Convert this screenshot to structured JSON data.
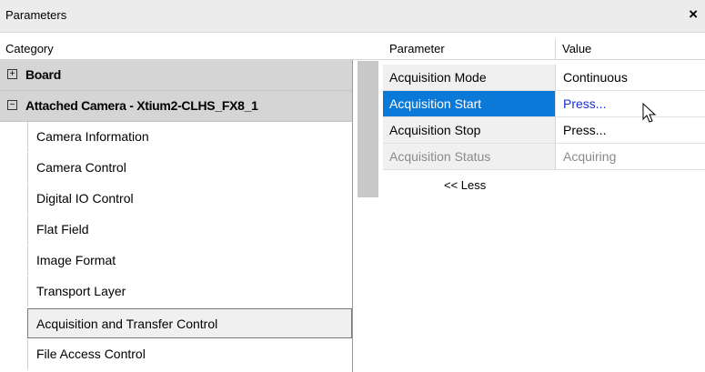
{
  "window": {
    "title": "Parameters",
    "close_glyph": "×"
  },
  "headers": {
    "category": "Category",
    "parameter": "Parameter",
    "value": "Value"
  },
  "categories": {
    "board": {
      "label": "Board",
      "expander": "+"
    },
    "camera": {
      "label": "Attached Camera - Xtium2-CLHS_FX8_1",
      "expander": "−"
    },
    "items": [
      "Camera Information",
      "Camera Control",
      "Digital IO Control",
      "Flat Field",
      "Image Format",
      "Transport Layer",
      "Acquisition and Transfer Control",
      "File Access Control"
    ],
    "selected_item": "Acquisition and Transfer Control"
  },
  "parameters": [
    {
      "name": "Acquisition Mode",
      "value": "Continuous"
    },
    {
      "name": "Acquisition Start",
      "value": "Press..."
    },
    {
      "name": "Acquisition Stop",
      "value": "Press..."
    },
    {
      "name": "Acquisition Status",
      "value": "Acquiring"
    }
  ],
  "less_link": "<< Less",
  "colors": {
    "selection": "#0b79d7",
    "link": "#1c2fd3",
    "disabled": "#8a8a8a"
  }
}
